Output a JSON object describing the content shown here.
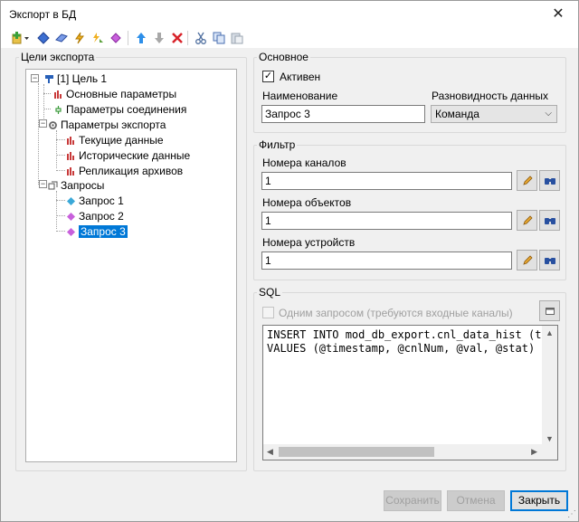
{
  "window": {
    "title": "Экспорт в БД",
    "close_glyph": "✕"
  },
  "toolbar": {
    "items": [
      {
        "icon": "add-target-icon",
        "color": "#c9a227"
      },
      {
        "icon": "add-query-icon",
        "color": "#3d6fd1"
      },
      {
        "icon": "add-query-alt-icon",
        "color": "#5a7fe0"
      },
      {
        "icon": "lightning-icon",
        "color": "#e8a317"
      },
      {
        "icon": "lightning-alt-icon",
        "color": "#6aa83e"
      },
      {
        "icon": "gem-icon",
        "color": "#b040c8"
      },
      {
        "icon": "move-up-icon",
        "color": "#2d7fd9"
      },
      {
        "icon": "move-down-icon",
        "color": "#a8a8a8"
      },
      {
        "icon": "delete-icon",
        "color": "#d8232a"
      },
      {
        "icon": "cut-icon",
        "color": "#5070a0"
      },
      {
        "icon": "copy-icon",
        "color": "#4a6fb0"
      },
      {
        "icon": "paste-icon",
        "color": "#9aa4b0"
      }
    ]
  },
  "targets": {
    "group_title": "Цели экспорта",
    "tree": [
      {
        "label": "[1] Цель 1",
        "icon": "target-icon"
      },
      {
        "label": "Основные параметры",
        "icon": "params-icon"
      },
      {
        "label": "Параметры соединения",
        "icon": "connection-icon"
      },
      {
        "label": "Параметры экспорта",
        "icon": "export-params-icon"
      },
      {
        "label": "Текущие данные",
        "icon": "params-icon"
      },
      {
        "label": "Исторические данные",
        "icon": "params-icon"
      },
      {
        "label": "Репликация архивов",
        "icon": "params-icon"
      },
      {
        "label": "Запросы",
        "icon": "queries-icon"
      },
      {
        "label": "Запрос 1",
        "icon": "query-icon"
      },
      {
        "label": "Запрос 2",
        "icon": "query-icon"
      },
      {
        "label": "Запрос 3",
        "icon": "query-icon"
      }
    ],
    "expander_minus": "−"
  },
  "general": {
    "group_title": "Основное",
    "active_label": "Активен",
    "active_check": "✓",
    "name_label": "Наименование",
    "name_value": "Запрос 3",
    "kind_label": "Разновидность данных",
    "kind_value": "Команда",
    "combo_arrow": "⌵"
  },
  "filter": {
    "group_title": "Фильтр",
    "channels_label": "Номера каналов",
    "channels_value": "1",
    "objects_label": "Номера объектов",
    "objects_value": "1",
    "devices_label": "Номера устройств",
    "devices_value": "1"
  },
  "sql": {
    "group_title": "SQL",
    "single_query_label": "Одним запросом (требуются входные каналы)",
    "text": "INSERT INTO mod_db_export.cnl_data_hist (time_stamp, cnl_num, val, stat)\nVALUES (@timestamp, @cnlNum, @val, @stat)",
    "scroll_up": "▲",
    "scroll_down": "▼",
    "scroll_left": "◀",
    "scroll_right": "▶"
  },
  "buttons": {
    "save": "Сохранить",
    "cancel": "Отмена",
    "close": "Закрыть"
  },
  "colors": {
    "accent": "#0078d7",
    "disabled_text": "#a0a0a0"
  }
}
